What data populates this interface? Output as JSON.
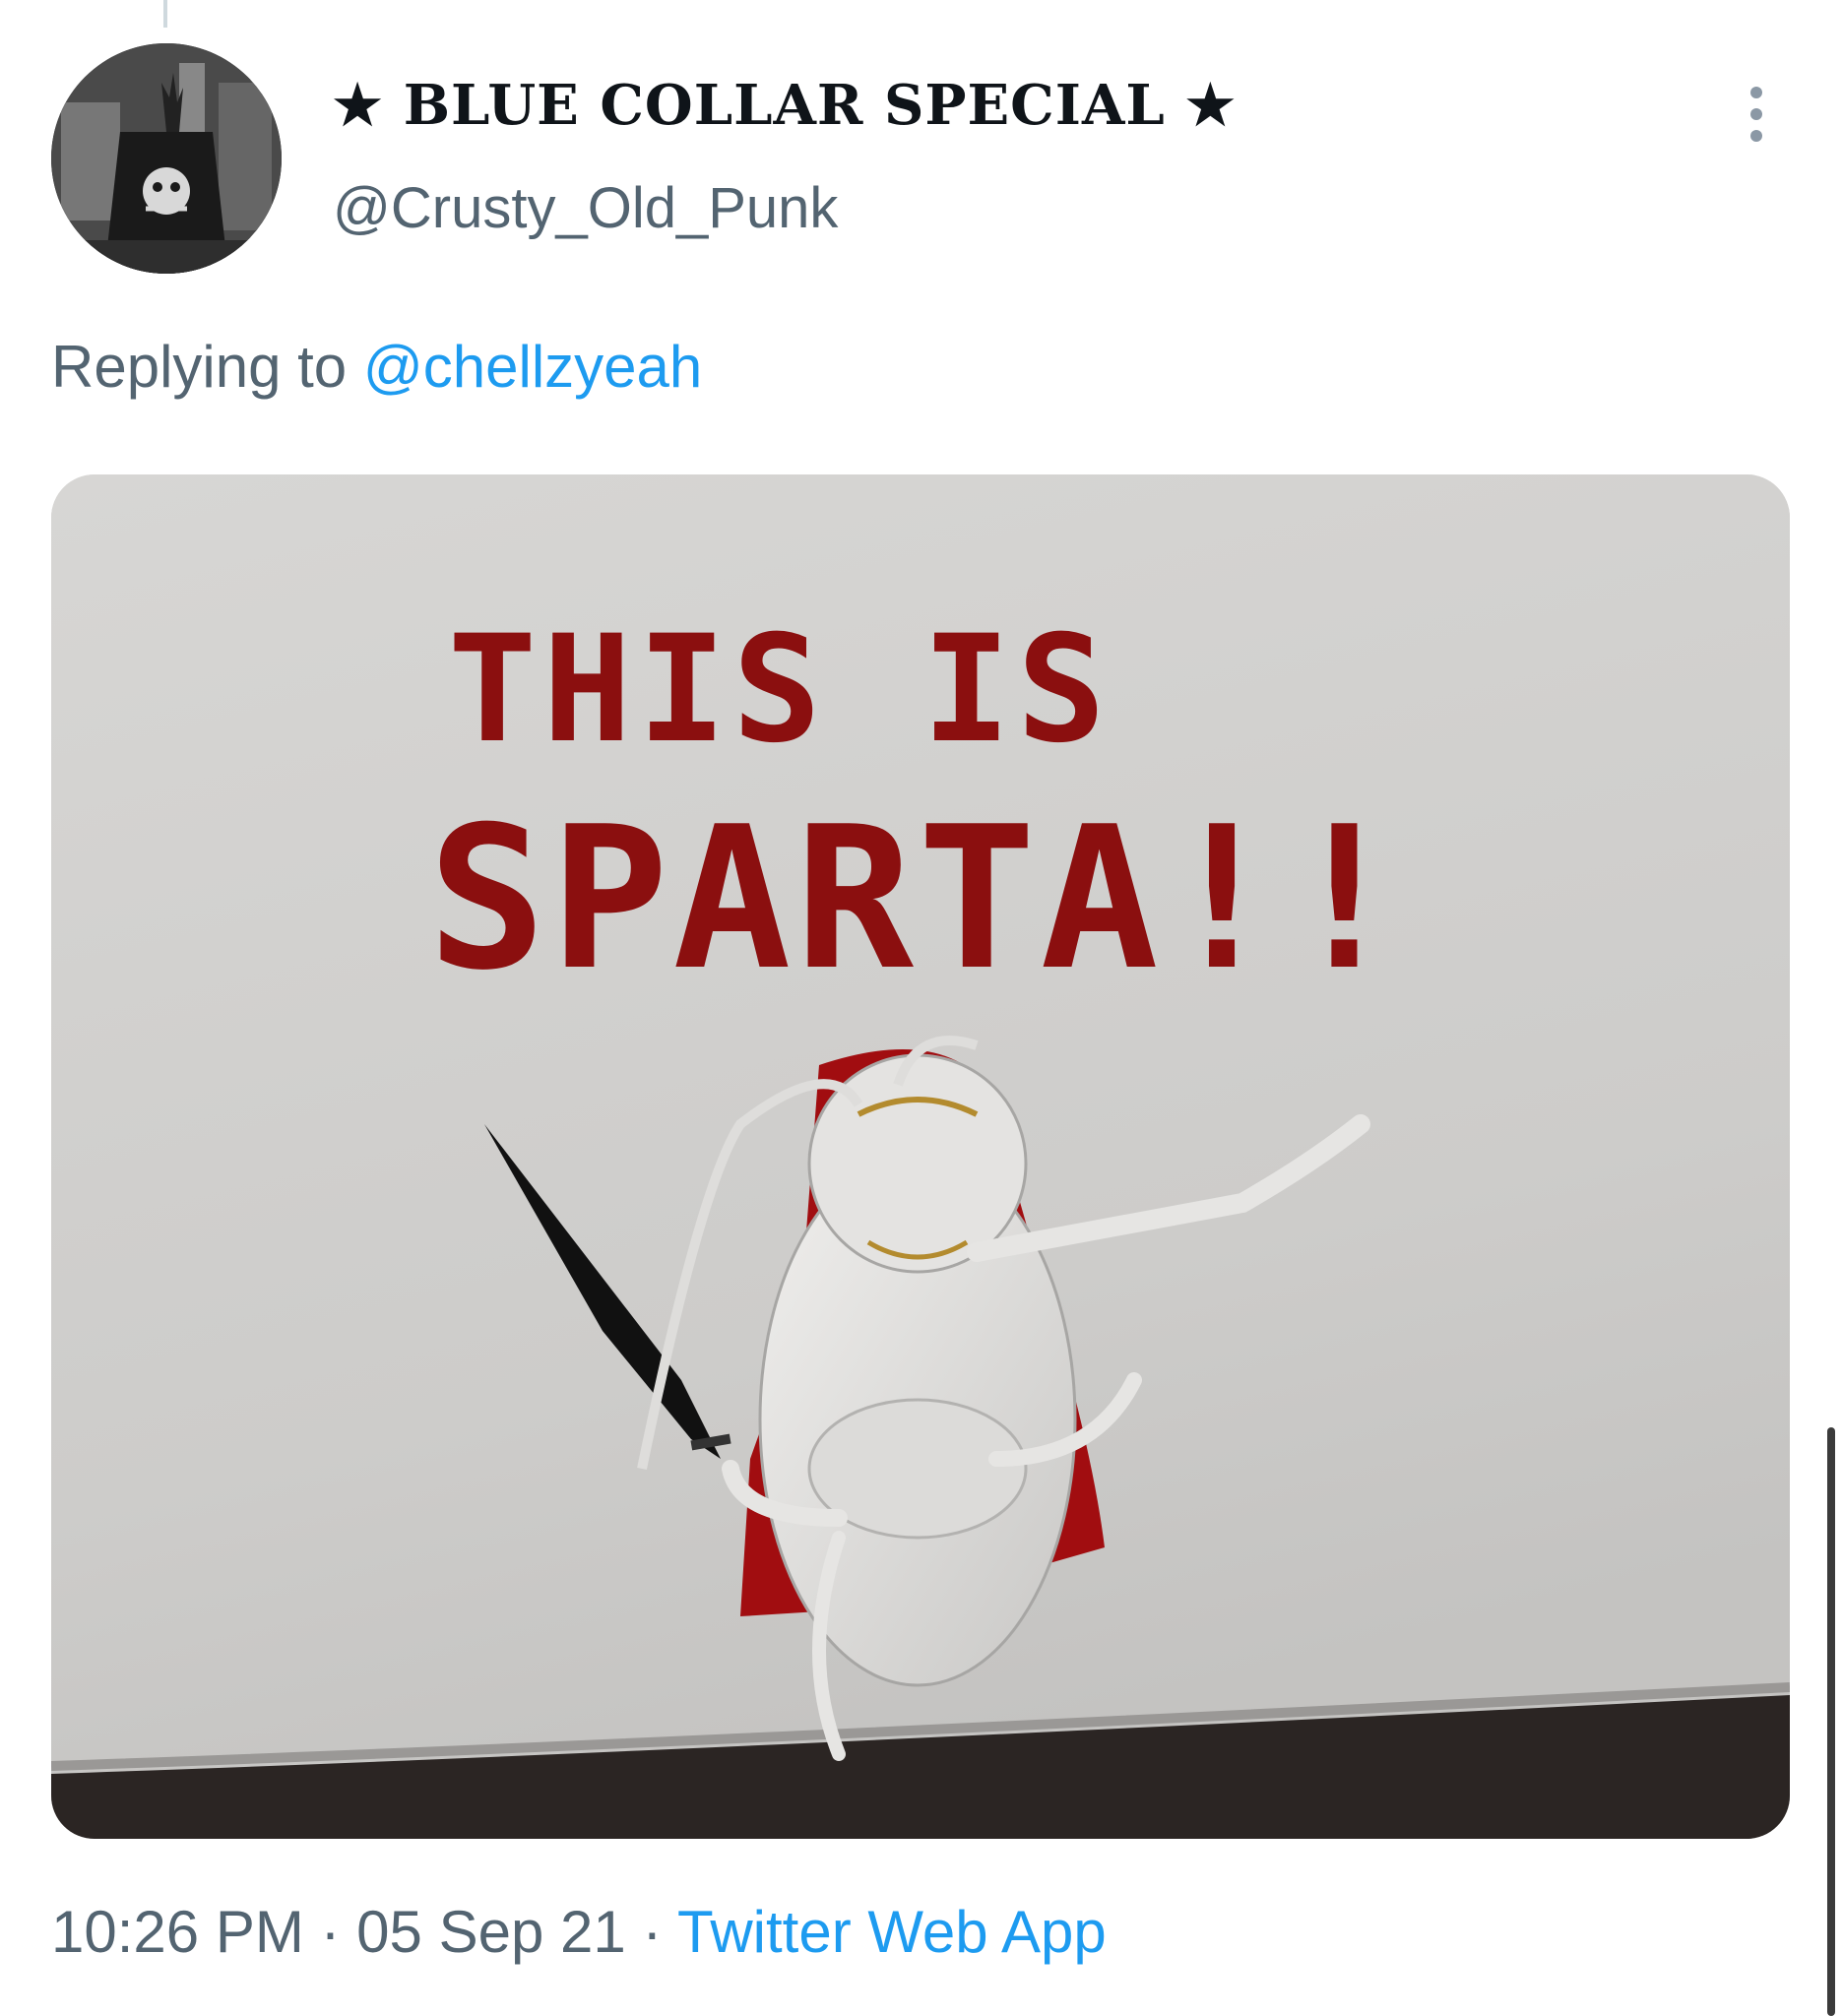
{
  "tweet": {
    "display_name": "★ BLUE COLLAR SPECIAL ★",
    "handle": "@Crusty_Old_Punk",
    "replying_prefix": "Replying to ",
    "replying_to": "@chellzyeah",
    "media": {
      "caption_line1": "THIS IS",
      "caption_line2": "SPARTA!!"
    },
    "time": "10:26 PM",
    "separator": " · ",
    "date": "05 Sep 21",
    "source": "Twitter Web App"
  },
  "colors": {
    "text_primary": "#0f1419",
    "text_secondary": "#536471",
    "link": "#1d9bf0",
    "sparta_red": "#8b0f0f",
    "cape_red": "#a10d10"
  },
  "icons": {
    "more": "more-vertical-icon"
  }
}
